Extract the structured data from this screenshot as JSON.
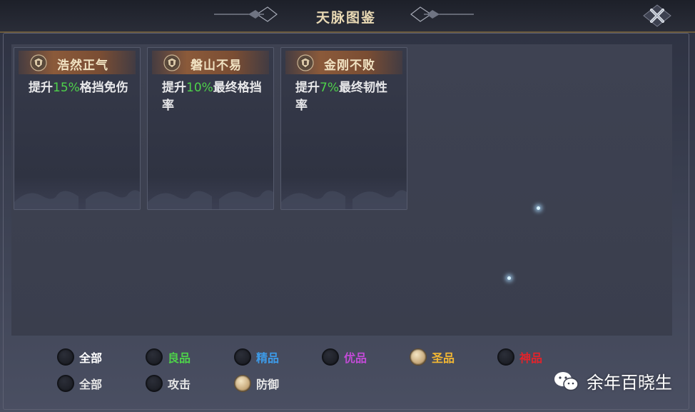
{
  "window": {
    "title": "天脉图鉴",
    "close_icon": "close-x-icon"
  },
  "cards": [
    {
      "name": "浩然正气",
      "icon": "shield-badge-icon",
      "desc_prefix": "提升",
      "percent": "15%",
      "desc_suffix": "格挡免伤"
    },
    {
      "name": "磐山不易",
      "icon": "shield-badge-icon",
      "desc_prefix": "提升",
      "percent": "10%",
      "desc_suffix": "最终格挡率"
    },
    {
      "name": "金刚不败",
      "icon": "shield-badge-icon",
      "desc_prefix": "提升",
      "percent": "7%",
      "desc_suffix": "最终韧性率"
    }
  ],
  "quality_filters": [
    {
      "label": "全部",
      "color": "#ffffff",
      "selected": false
    },
    {
      "label": "良品",
      "color": "#4ed14a",
      "selected": false
    },
    {
      "label": "精品",
      "color": "#3d9be9",
      "selected": false
    },
    {
      "label": "优品",
      "color": "#c24bd6",
      "selected": false
    },
    {
      "label": "圣品",
      "color": "#f2b733",
      "selected": true
    },
    {
      "label": "神品",
      "color": "#e2232b",
      "selected": false
    }
  ],
  "type_filters": [
    {
      "label": "全部",
      "color": "#e6e6e6",
      "selected": false
    },
    {
      "label": "攻击",
      "color": "#e6e6e6",
      "selected": false
    },
    {
      "label": "防御",
      "color": "#e6e6e6",
      "selected": true
    }
  ],
  "watermark": {
    "icon": "wechat-icon",
    "text": "余年百晓生"
  },
  "colors": {
    "percent_highlight": "#4ed14a",
    "title": "#e9d9b4"
  }
}
